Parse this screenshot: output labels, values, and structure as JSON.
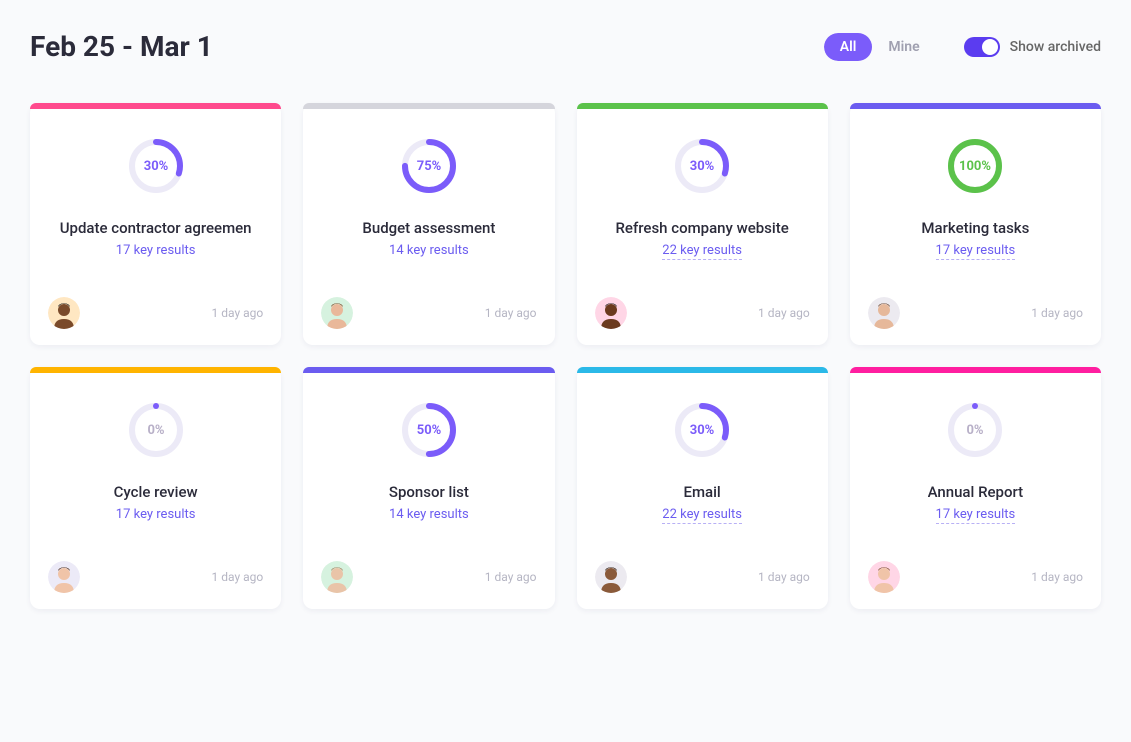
{
  "header": {
    "date_range": "Feb 25 - Mar 1",
    "filter_all": "All",
    "filter_mine": "Mine",
    "toggle_label": "Show archived"
  },
  "colors": {
    "purple": "#7b5cfa",
    "green": "#5bc24a",
    "track": "#eceaf7"
  },
  "cards": [
    {
      "accent": "#ff4a8d",
      "progress": 30,
      "progress_label": "30%",
      "ring_color": "#7b5cfa",
      "label_color": "#7b5cfa",
      "title": "Update contractor agreemen",
      "subtitle": "17 key results",
      "subtitle_dashed": false,
      "timestamp": "1 day ago",
      "avatar_bg": "#ffe7c2",
      "avatar_skin": "#7a4a2a",
      "avatar_hair": "#1e1e1e"
    },
    {
      "accent": "#d5d5dc",
      "progress": 75,
      "progress_label": "75%",
      "ring_color": "#7b5cfa",
      "label_color": "#7b5cfa",
      "title": "Budget assessment",
      "subtitle": "14 key results",
      "subtitle_dashed": false,
      "timestamp": "1 day ago",
      "avatar_bg": "#d6f2df",
      "avatar_skin": "#e9b89a",
      "avatar_hair": "#7a4a2a"
    },
    {
      "accent": "#5bc24a",
      "progress": 30,
      "progress_label": "30%",
      "ring_color": "#7b5cfa",
      "label_color": "#7b5cfa",
      "title": "Refresh company website",
      "subtitle": "22 key results",
      "subtitle_dashed": true,
      "timestamp": "1 day ago",
      "avatar_bg": "#ffd6e6",
      "avatar_skin": "#6b3a1e",
      "avatar_hair": "#1e1e1e"
    },
    {
      "accent": "#6b5cf0",
      "progress": 100,
      "progress_label": "100%",
      "ring_color": "#5bc24a",
      "label_color": "#5bc24a",
      "title": "Marketing tasks",
      "subtitle": "17 key results",
      "subtitle_dashed": true,
      "timestamp": "1 day ago",
      "avatar_bg": "#eceaf0",
      "avatar_skin": "#e6b89a",
      "avatar_hair": "#6a4630"
    },
    {
      "accent": "#ffb400",
      "progress": 0,
      "progress_label": "0%",
      "ring_color": "#7b5cfa",
      "label_color": "#b8b0c8",
      "title": "Cycle review",
      "subtitle": "17 key results",
      "subtitle_dashed": false,
      "timestamp": "1 day ago",
      "avatar_bg": "#eceaf7",
      "avatar_skin": "#f0c4a8",
      "avatar_hair": "#4a2a1a"
    },
    {
      "accent": "#6b5cf0",
      "progress": 50,
      "progress_label": "50%",
      "ring_color": "#7b5cfa",
      "label_color": "#7b5cfa",
      "title": "Sponsor list",
      "subtitle": "14 key results",
      "subtitle_dashed": false,
      "timestamp": "1 day ago",
      "avatar_bg": "#d6f2df",
      "avatar_skin": "#e9c4a8",
      "avatar_hair": "#a08060"
    },
    {
      "accent": "#2bb9e8",
      "progress": 30,
      "progress_label": "30%",
      "ring_color": "#7b5cfa",
      "label_color": "#7b5cfa",
      "title": "Email",
      "subtitle": "22 key results",
      "subtitle_dashed": true,
      "timestamp": "1 day ago",
      "avatar_bg": "#eceaf0",
      "avatar_skin": "#8a5a3a",
      "avatar_hair": "#2a1a10"
    },
    {
      "accent": "#ff1fa0",
      "progress": 0,
      "progress_label": "0%",
      "ring_color": "#7b5cfa",
      "label_color": "#b8b0c8",
      "title": "Annual Report",
      "subtitle": "17 key results",
      "subtitle_dashed": true,
      "timestamp": "1 day ago",
      "avatar_bg": "#ffd6e6",
      "avatar_skin": "#f0c4a8",
      "avatar_hair": "#7a4a2a"
    }
  ]
}
